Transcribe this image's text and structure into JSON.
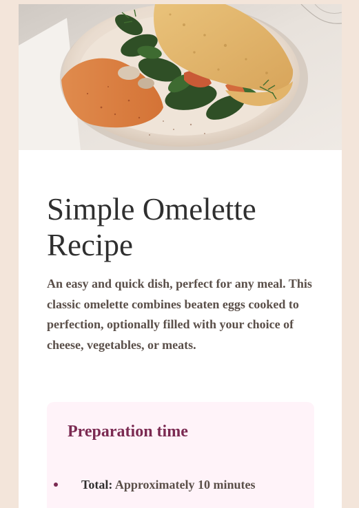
{
  "recipe": {
    "title": "Simple Omelette Recipe",
    "description": "An easy and quick dish, perfect for any meal. This classic omelette combines beaten eggs cooked to perfection, optionally filled with your choice of cheese, vegetables, or meats."
  },
  "preparation": {
    "heading": "Preparation time",
    "items": [
      {
        "label": "Total:",
        "value": "Approximately 10 minutes"
      }
    ]
  },
  "colors": {
    "page_background": "#f3e5da",
    "card_background": "#ffffff",
    "accent": "#7b2a52",
    "prep_background": "#fff3f9"
  },
  "hero_image": {
    "subject": "omelette-photo"
  }
}
